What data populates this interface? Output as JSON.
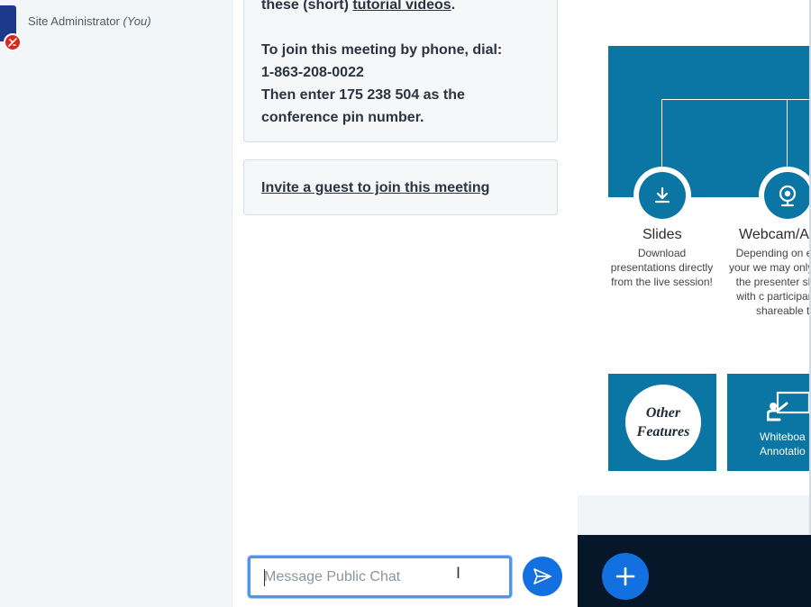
{
  "userlist": {
    "current_user": {
      "name": "Site Administrator",
      "you_label": "(You)"
    }
  },
  "chat": {
    "welcome": {
      "line1_prefix": "these (short) ",
      "line1_link": "tutorial videos",
      "line1_suffix": ".",
      "phone_intro": "To join this meeting by phone, dial:",
      "phone_number": "1-863-208-0022",
      "pin_text": "Then enter 175 238 504 as the conference pin number."
    },
    "invite_link": "Invite a guest to join this meeting",
    "input": {
      "placeholder": "Message Public Chat",
      "value": ""
    },
    "colors": {
      "accent": "#1270e0",
      "input_focus": "#4d94f0"
    }
  },
  "presentation": {
    "slide": {
      "features": [
        {
          "title": "Slides",
          "description": "Download presentations directly from the live session!",
          "icon": "download-icon"
        },
        {
          "title": "Webcam/A",
          "description": "Depending on event, your we may only be se the presenter shared with c participants. A shareable to",
          "icon": "webcam-icon"
        }
      ],
      "tiles": {
        "other_features_line1": "Other",
        "other_features_line2": "Features",
        "whiteboard_line1": "Whiteboa",
        "whiteboard_line2": "Annotatio"
      },
      "colors": {
        "brand_blue": "#0b75a4"
      }
    },
    "toolbar": {
      "actions_icon": "plus-icon",
      "background": "#06172a"
    }
  }
}
